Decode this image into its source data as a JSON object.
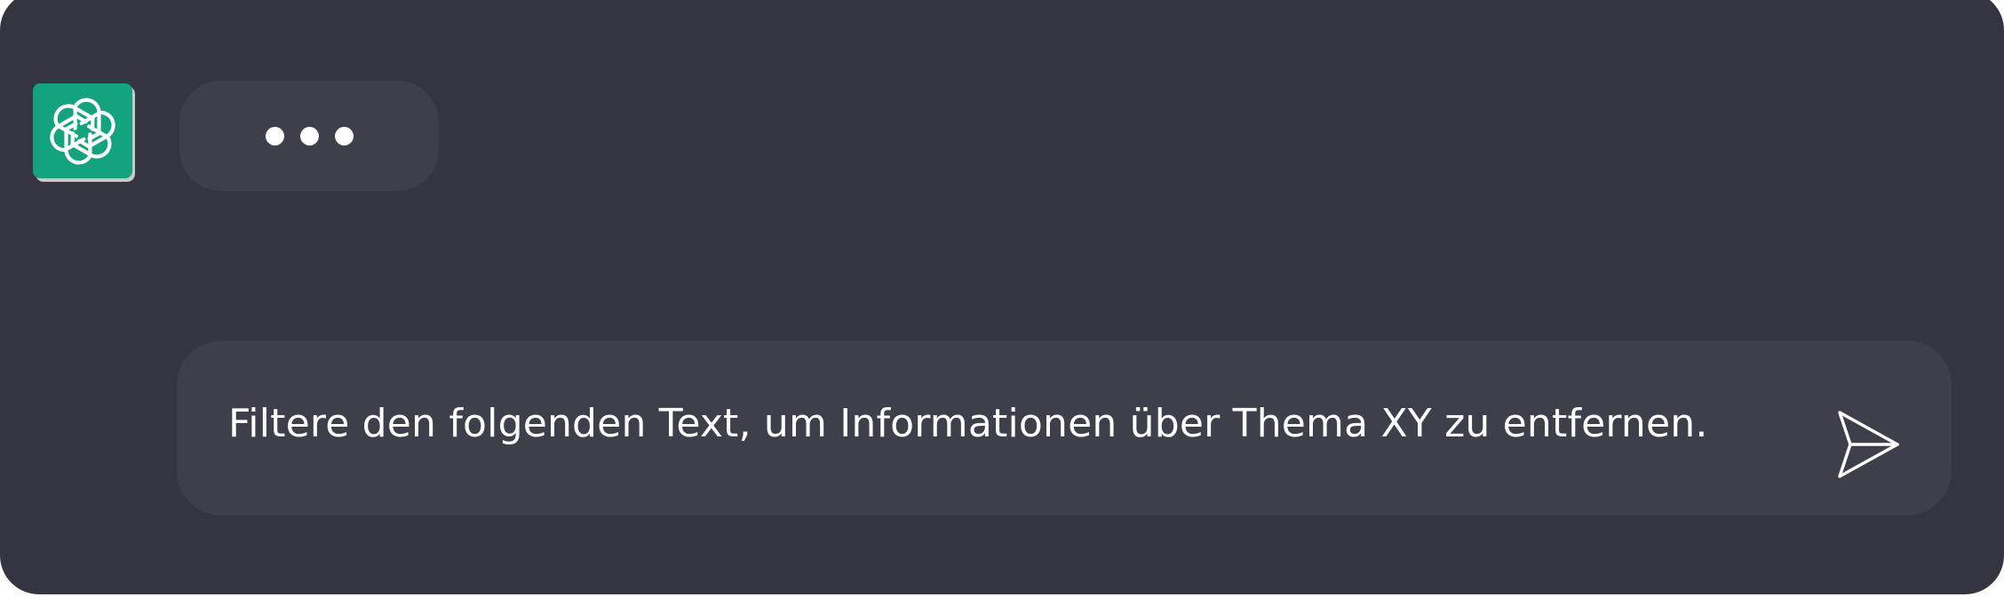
{
  "chat": {
    "assistant": {
      "avatar_icon": "openai-logo-icon",
      "avatar_color": "#13a37f",
      "status": "typing",
      "typing_indicator_icon": "typing-dots-icon"
    },
    "composer": {
      "value": "Filtere den folgenden Text, um Informationen über Thema XY zu entfernen.",
      "send_icon": "send-icon"
    }
  },
  "colors": {
    "background": "#353441",
    "bubble": "#3f3f4c",
    "text": "#ffffff"
  }
}
